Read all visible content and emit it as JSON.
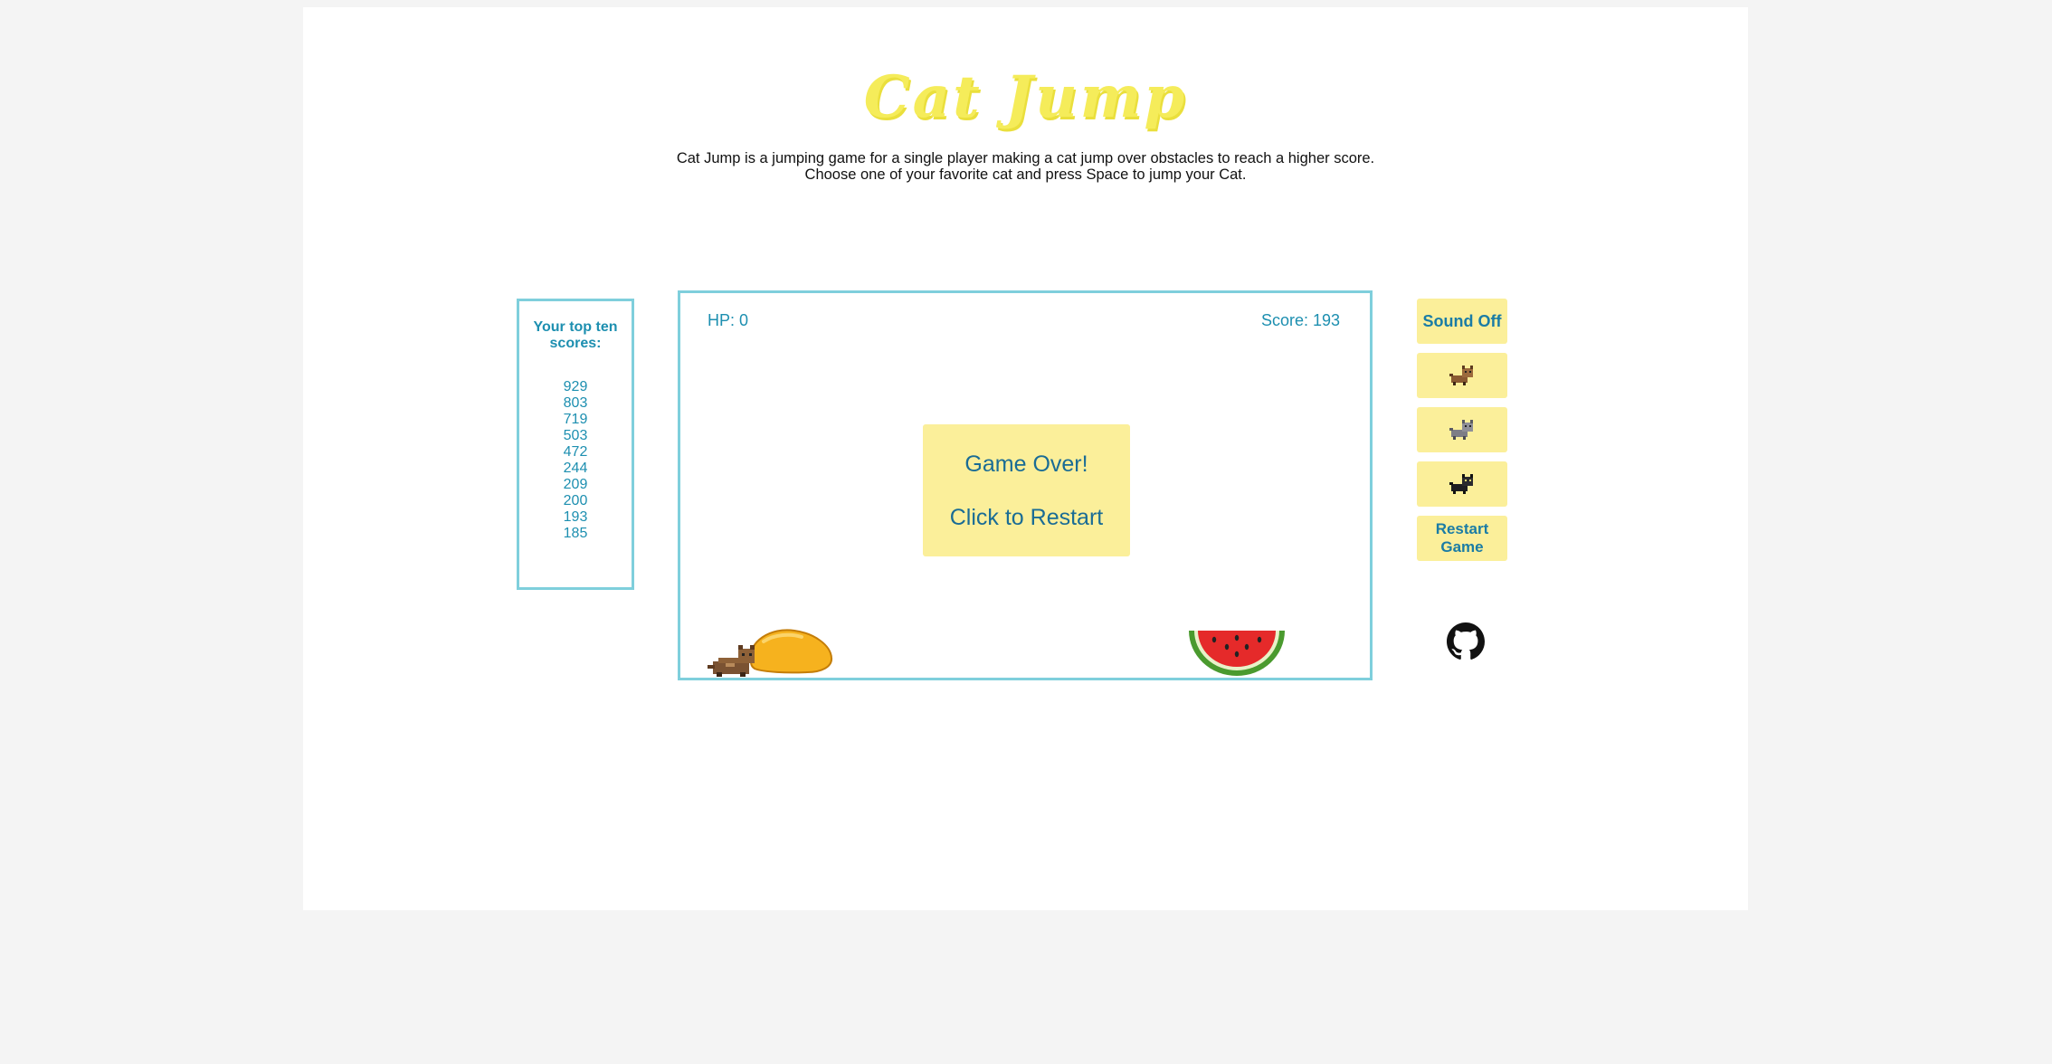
{
  "title": "Cat Jump",
  "description": {
    "line1": "Cat Jump is a jumping game for a single player making a cat jump over obstacles to reach a higher score.",
    "line2": "Choose one of your favorite cat and press Space to jump your Cat."
  },
  "scoreboard": {
    "title": "Your top ten scores:",
    "scores": [
      "929",
      "803",
      "719",
      "503",
      "472",
      "244",
      "209",
      "200",
      "193",
      "185"
    ]
  },
  "game": {
    "hp": "HP: 0",
    "score": "Score: 193",
    "overlay": {
      "line1": "Game Over!",
      "line2": "Click to Restart"
    }
  },
  "sidebar": {
    "sound_label": "Sound Off",
    "cats": [
      {
        "icon": "brown-cat-icon"
      },
      {
        "icon": "gray-cat-icon"
      },
      {
        "icon": "black-cat-icon"
      }
    ],
    "restart_label_line1": "Restart",
    "restart_label_line2": "Game"
  },
  "colors": {
    "title": "#f5ec5a",
    "accent": "#1d8fb0",
    "border": "#7fcfdc",
    "button_bg": "#fbef9a"
  }
}
